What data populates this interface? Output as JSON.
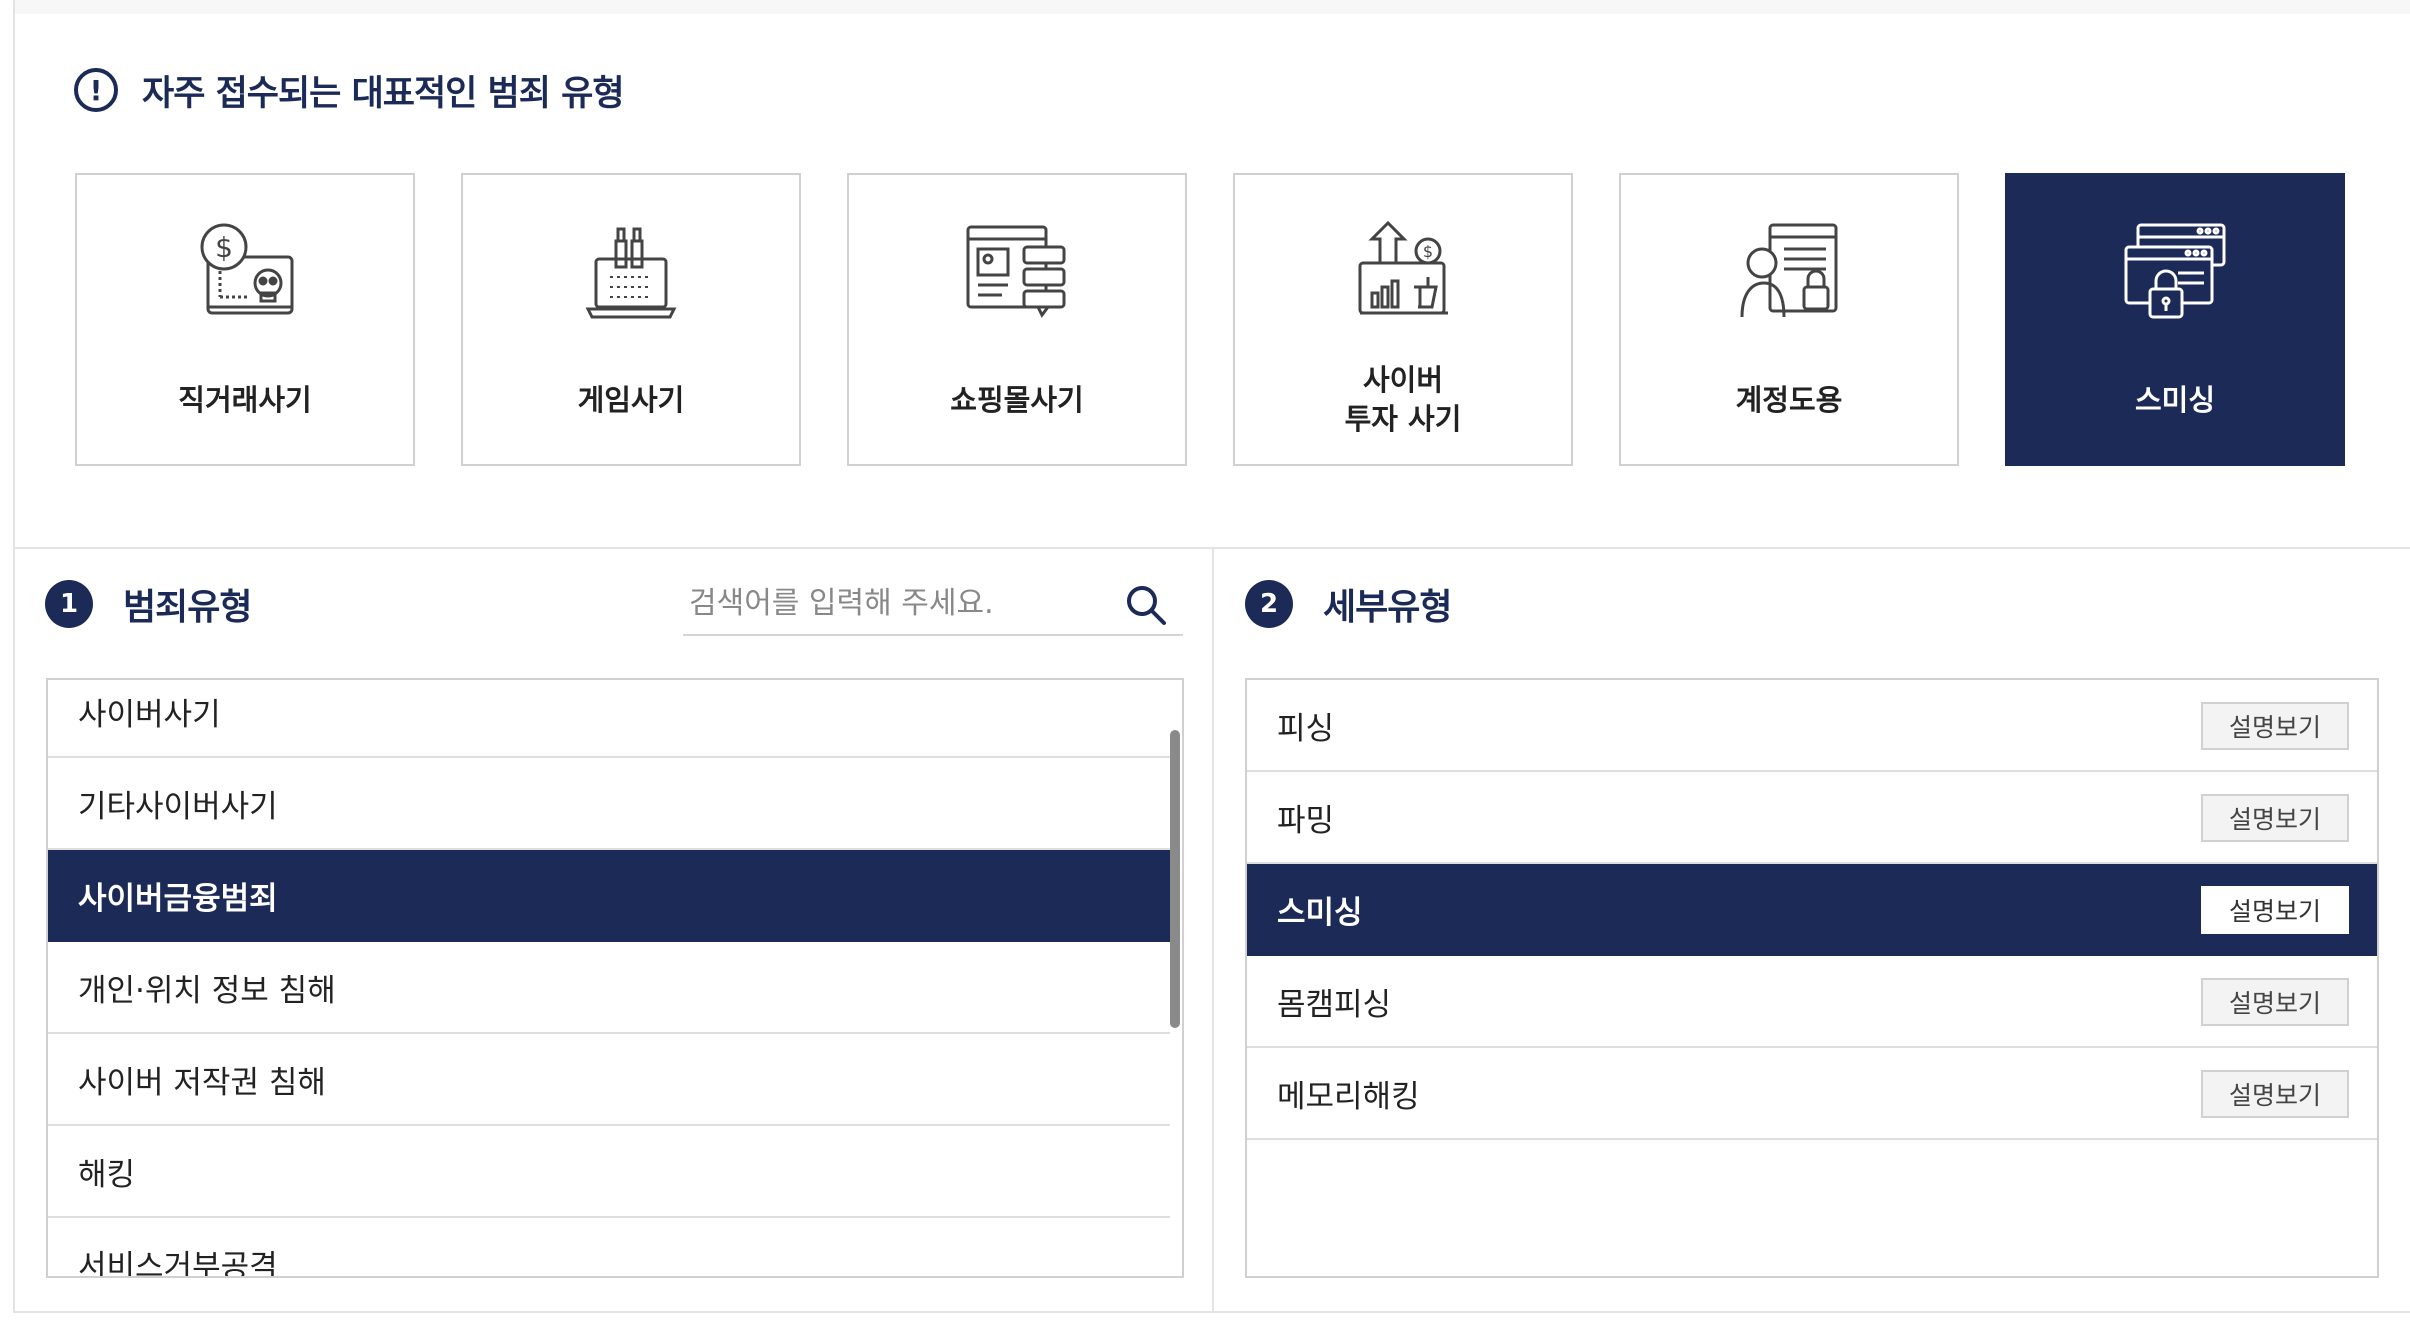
{
  "featured": {
    "title": "자주 접수되는 대표적인 범죄 유형",
    "cards": [
      {
        "label": "직거래사기",
        "icon": "laptop-money-skull-icon",
        "active": false
      },
      {
        "label": "게임사기",
        "icon": "laptop-game-icon",
        "active": false
      },
      {
        "label": "쇼핑몰사기",
        "icon": "webpage-chat-icon",
        "active": false
      },
      {
        "label": "사이버\n투자 사기",
        "icon": "investment-growth-icon",
        "active": false
      },
      {
        "label": "계정도용",
        "icon": "hacker-lock-icon",
        "active": false
      },
      {
        "label": "스미싱",
        "icon": "browser-lock-icon",
        "active": true
      }
    ]
  },
  "crime_types": {
    "number": "1",
    "title": "범죄유형",
    "search_placeholder": "검색어를 입력해 주세요.",
    "items": [
      {
        "label": "사이버사기",
        "active": false
      },
      {
        "label": "기타사이버사기",
        "active": false
      },
      {
        "label": "사이버금융범죄",
        "active": true
      },
      {
        "label": "개인·위치 정보 침해",
        "active": false
      },
      {
        "label": "사이버 저작권 침해",
        "active": false
      },
      {
        "label": "해킹",
        "active": false
      },
      {
        "label": "서비스거부공격",
        "active": false
      }
    ]
  },
  "sub_types": {
    "number": "2",
    "title": "세부유형",
    "button_label": "설명보기",
    "items": [
      {
        "label": "피싱",
        "active": false
      },
      {
        "label": "파밍",
        "active": false
      },
      {
        "label": "스미싱",
        "active": true
      },
      {
        "label": "몸캠피싱",
        "active": false
      },
      {
        "label": "메모리해킹",
        "active": false
      }
    ]
  },
  "colors": {
    "primary": "#1b2a56",
    "border": "#d0d0d0"
  }
}
